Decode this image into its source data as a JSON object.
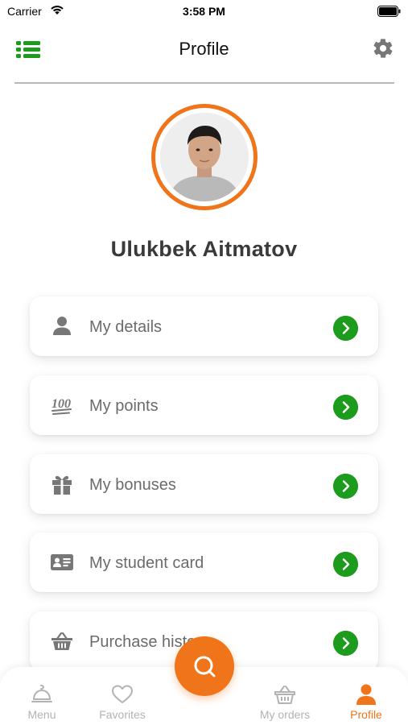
{
  "status_bar": {
    "carrier": "Carrier",
    "time": "3:58 PM"
  },
  "header": {
    "title": "Profile"
  },
  "profile": {
    "name": "Ulukbek Aitmatov"
  },
  "menu": [
    {
      "label": "My details",
      "icon": "person-icon"
    },
    {
      "label": "My points",
      "icon": "hundred-points-icon"
    },
    {
      "label": "My bonuses",
      "icon": "gift-icon"
    },
    {
      "label": "My student card",
      "icon": "id-card-icon"
    },
    {
      "label": "Purchase history",
      "icon": "basket-icon"
    }
  ],
  "tabbar": {
    "menu": "Menu",
    "favorites": "Favorites",
    "orders": "My orders",
    "profile": "Profile"
  },
  "colors": {
    "accent": "#f07419",
    "arrow": "#1c9b1c",
    "icon": "#777777",
    "tab_inactive": "#b3b3b3"
  }
}
